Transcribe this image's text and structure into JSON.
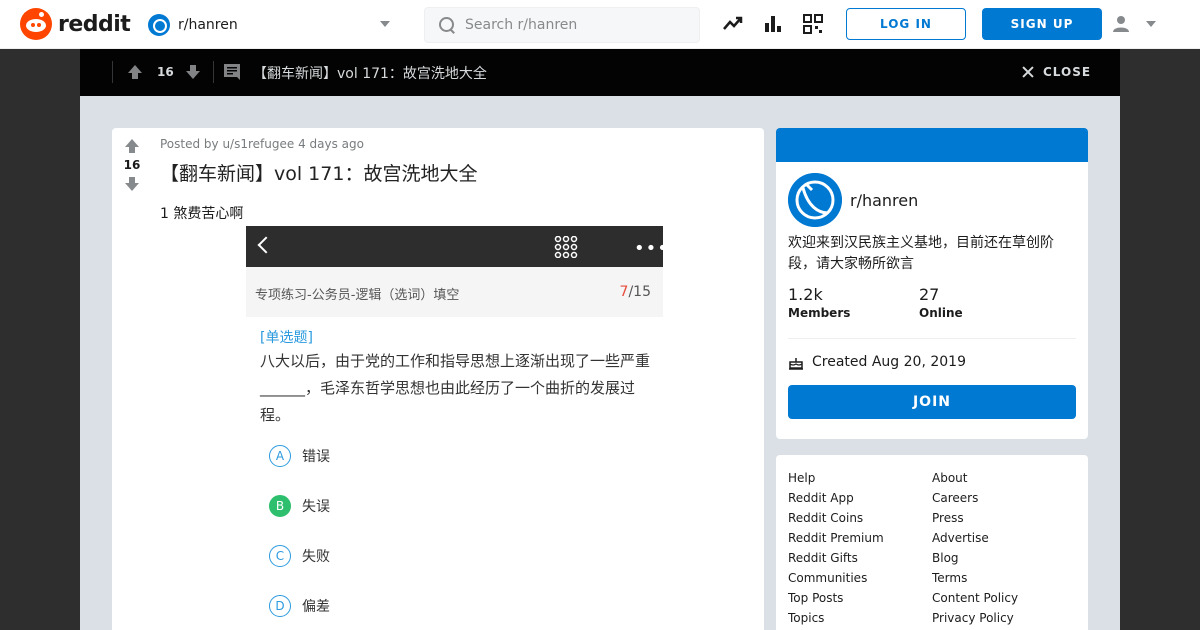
{
  "header": {
    "logo_text": "reddit",
    "community": "r/hanren",
    "search_placeholder": "Search r/hanren",
    "login_label": "LOG IN",
    "signup_label": "SIGN UP",
    "icons": [
      "trending-icon",
      "leaderboard-icon",
      "qr-icon",
      "user-icon"
    ]
  },
  "overlay": {
    "score": "16",
    "title": "【翻车新闻】vol 171：故宫洗地大全",
    "close_label": "CLOSE"
  },
  "post": {
    "meta": "Posted by u/s1refugee 4 days ago",
    "score": "16",
    "title": "【翻车新闻】vol 171：故宫洗地大全",
    "body": "1 煞费苦心啊",
    "screenshot": {
      "subtitle": "专项练习-公务员-逻辑（选词）填空",
      "count_current": "7",
      "count_total": "/15",
      "type": "[单选题]",
      "question": "八大以后，由于党的工作和指导思想上逐渐出现了一些严重______，毛泽东哲学思想也由此经历了一个曲折的发展过程。",
      "options": [
        {
          "letter": "A",
          "text": "错误",
          "correct": false
        },
        {
          "letter": "B",
          "text": "失误",
          "correct": true
        },
        {
          "letter": "C",
          "text": "失败",
          "correct": false
        },
        {
          "letter": "D",
          "text": "偏差",
          "correct": false
        }
      ]
    }
  },
  "sidebar": {
    "name": "r/hanren",
    "description": "欢迎来到汉民族主义基地，目前还在草创阶段，请大家畅所欲言",
    "members": "1.2k",
    "members_label": "Members",
    "online": "27",
    "online_label": "Online",
    "created": "Created Aug 20, 2019",
    "join_label": "JOIN"
  },
  "footer": {
    "left": [
      "Help",
      "Reddit App",
      "Reddit Coins",
      "Reddit Premium",
      "Reddit Gifts",
      "Communities",
      "Top Posts",
      "Topics"
    ],
    "right": [
      "About",
      "Careers",
      "Press",
      "Advertise",
      "Blog",
      "Terms",
      "Content Policy",
      "Privacy Policy"
    ]
  },
  "colors": {
    "brand": "#ff4500",
    "accent": "#0079d3",
    "correct": "#2dbf6e"
  }
}
